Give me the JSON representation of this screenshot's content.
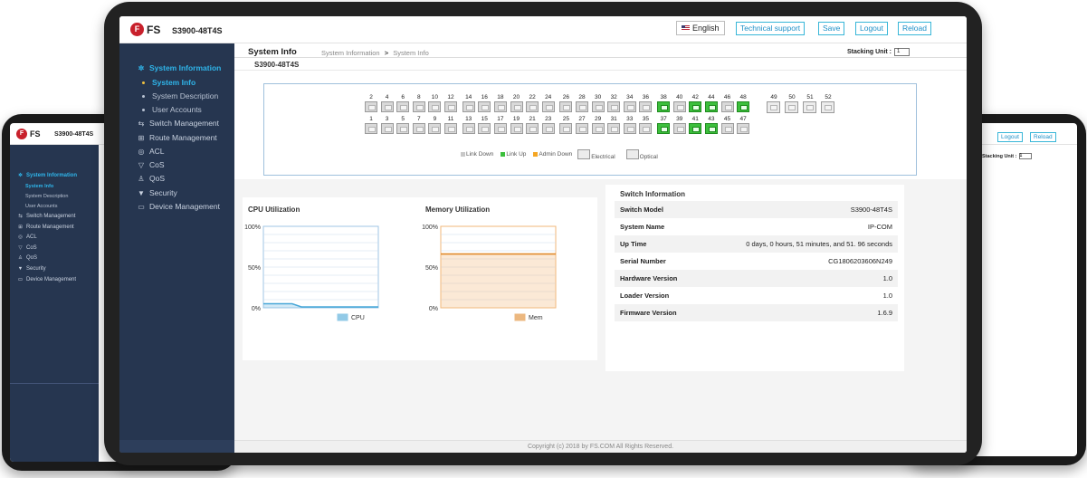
{
  "brand": {
    "logo_text": "FS",
    "logo_mark": "F",
    "model": "S3900-48T4S"
  },
  "header": {
    "language": "English",
    "technical_support": "Technical support",
    "save": "Save",
    "logout": "Logout",
    "reload": "Reload"
  },
  "sidebar": {
    "items": [
      {
        "label": "System Information",
        "icon": "gear-icon",
        "glyph": "✲",
        "active": true,
        "children": [
          {
            "label": "System Info",
            "active": true
          },
          {
            "label": "System Description",
            "active": false
          },
          {
            "label": "User Accounts",
            "active": false
          }
        ]
      },
      {
        "label": "Switch Management",
        "icon": "switch-icon",
        "glyph": "⇆"
      },
      {
        "label": "Route Management",
        "icon": "route-icon",
        "glyph": "⊞"
      },
      {
        "label": "ACL",
        "icon": "acl-icon",
        "glyph": "◎"
      },
      {
        "label": "CoS",
        "icon": "cos-icon",
        "glyph": "▽"
      },
      {
        "label": "QoS",
        "icon": "qos-icon",
        "glyph": "♙"
      },
      {
        "label": "Security",
        "icon": "shield-icon",
        "glyph": "▼"
      },
      {
        "label": "Device Management",
        "icon": "monitor-icon",
        "glyph": "▭"
      }
    ]
  },
  "page": {
    "title": "System Info",
    "breadcrumb": [
      "System Information",
      "System Info"
    ],
    "breadcrumb_sep": ">",
    "stacking_unit_label": "Stacking Unit :",
    "stacking_unit_value": "1",
    "panel_title": "S3900-48T4S"
  },
  "ports": {
    "top_row": [
      "2",
      "4",
      "6",
      "8",
      "10",
      "12",
      "14",
      "16",
      "18",
      "20",
      "22",
      "24",
      "26",
      "28",
      "30",
      "32",
      "34",
      "36",
      "38",
      "40",
      "42",
      "44",
      "46",
      "48"
    ],
    "bottom_row": [
      "1",
      "3",
      "5",
      "7",
      "9",
      "11",
      "13",
      "15",
      "17",
      "19",
      "21",
      "23",
      "25",
      "27",
      "29",
      "31",
      "33",
      "35",
      "37",
      "39",
      "41",
      "43",
      "45",
      "47"
    ],
    "optical": [
      "49",
      "50",
      "51",
      "52"
    ],
    "link_up": [
      "38",
      "42",
      "44",
      "48",
      "37",
      "41",
      "43"
    ],
    "legend": {
      "link_down": "Link Down",
      "link_up": "Link Up",
      "admin_down": "Admin Down",
      "electrical": "Electrical",
      "optical": "Optical"
    },
    "colors": {
      "link_down": "#c8c8c8",
      "link_up": "#3cbf3c",
      "admin_down": "#f5a623"
    }
  },
  "cpu": {
    "title": "CPU Utilization",
    "y_labels": [
      "100%",
      "50%",
      "0%"
    ],
    "legend": "CPU",
    "color": "#4aa8d8",
    "values": [
      5,
      5,
      5,
      5,
      1,
      1,
      1,
      1,
      1,
      1,
      1,
      1,
      1
    ]
  },
  "memory": {
    "title": "Memory Utilization",
    "y_labels": [
      "100%",
      "50%",
      "0%"
    ],
    "legend": "Mem",
    "color": "#e08a2c",
    "values": [
      66,
      66,
      66,
      66,
      66,
      66,
      66,
      66,
      66,
      66,
      66,
      66,
      66
    ]
  },
  "switch_info": {
    "title": "Switch Information",
    "rows": [
      {
        "key": "Switch Model",
        "value": "S3900-48T4S"
      },
      {
        "key": "System Name",
        "value": "IP-COM"
      },
      {
        "key": "Up Time",
        "value": "0 days, 0 hours, 51 minutes, and 51. 96 seconds"
      },
      {
        "key": "Serial Number",
        "value": "CG1806203606N249"
      },
      {
        "key": "Hardware Version",
        "value": "1.0"
      },
      {
        "key": "Loader Version",
        "value": "1.0"
      },
      {
        "key": "Firmware Version",
        "value": "1.6.9"
      }
    ]
  },
  "footer": "Copyright (c) 2018 by FS.COM All Rights Reserved."
}
